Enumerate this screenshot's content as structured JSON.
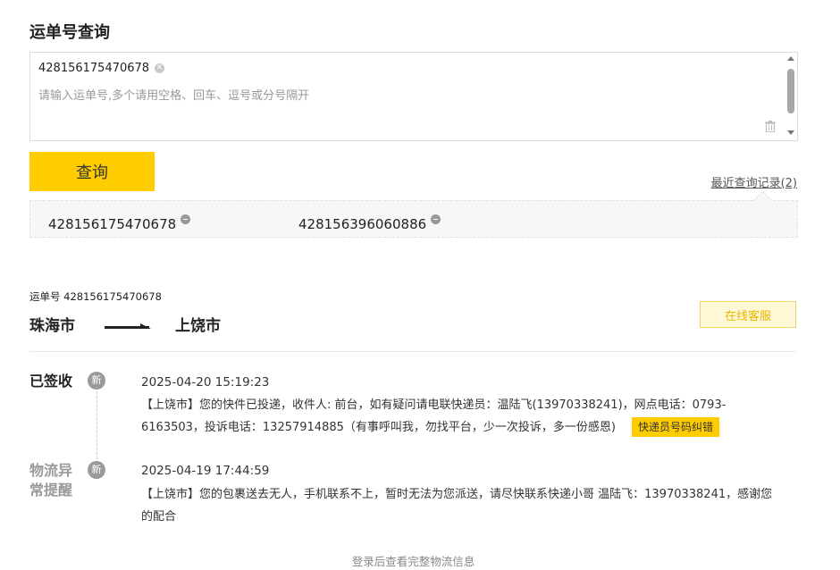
{
  "page": {
    "title": "运单号查询"
  },
  "query": {
    "tracking_tag": "428156175470678",
    "hint": "请输入运单号,多个请用空格、回车、逗号或分号隔开",
    "button_label": "查询",
    "recent_link": "最近查询记录(2)",
    "history": [
      "428156175470678",
      "428156396060886"
    ]
  },
  "result": {
    "waybill_label": "运单号 428156175470678",
    "from_city": "珠海市",
    "to_city": "上饶市",
    "service_button": "在线客服",
    "new_badge": "新",
    "events": [
      {
        "status": "已签收",
        "time": "2025-04-20 15:19:23",
        "desc": "【上饶市】您的快件已投递，收件人: 前台，如有疑问请电联快递员：温陆飞(13970338241)，网点电话：0793-6163503，投诉电话：13257914885（有事呼叫我，勿找平台，少一次投诉，多一份感恩)",
        "action": "快递员号码纠错"
      },
      {
        "status": "物流异常提醒",
        "time": "2025-04-19 17:44:59",
        "desc": "【上饶市】您的包裹送去无人，手机联系不上，暂时无法为您派送，请尽快联系快递小哥 温陆飞：13970338241，感谢您的配合"
      }
    ],
    "login_tip": "登录后查看完整物流信息"
  },
  "colors": {
    "accent": "#ffcc00",
    "service_text": "#e8b500",
    "muted": "#999999"
  },
  "icons": [
    "clear-icon",
    "trash-icon",
    "minus-icon",
    "route-arrow-icon",
    "new-badge"
  ]
}
